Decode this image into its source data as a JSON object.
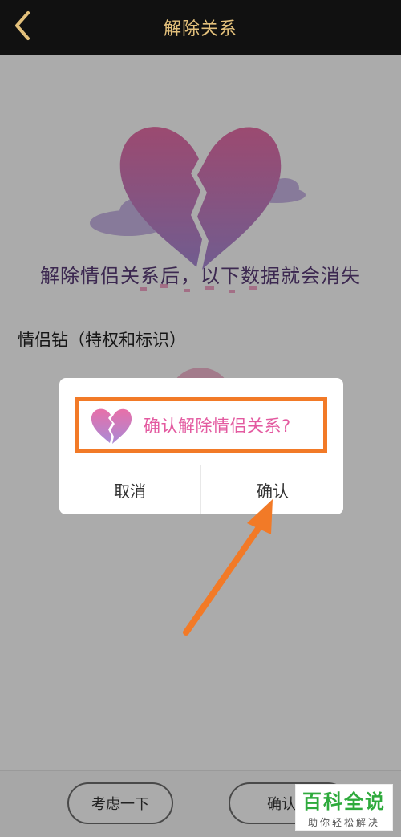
{
  "header": {
    "title": "解除关系",
    "back_icon": "chevron-left-icon",
    "back_color": "#e3c07b"
  },
  "page": {
    "loss_text": "解除情侣关系后，以下数据就会消失",
    "section_label": "情侣钻（特权和标识）",
    "footer": {
      "think_label": "考虑一下",
      "confirm_label": "确认解"
    }
  },
  "dialog": {
    "message": "确认解除情侣关系?",
    "icon": "broken-heart-icon",
    "cancel_label": "取消",
    "confirm_label": "确认",
    "highlight_color": "#f27a27"
  },
  "watermark": {
    "title": "百科全说",
    "subtitle": "助你轻松解决"
  },
  "colors": {
    "accent": "#e3c07b",
    "message": "#e35aa0",
    "heart_top": "#e86fa8",
    "heart_bottom": "#a98ad6"
  }
}
